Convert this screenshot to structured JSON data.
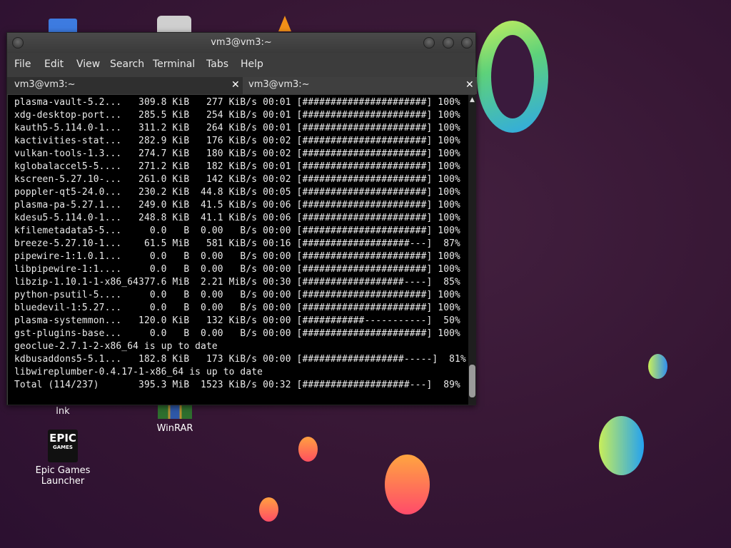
{
  "desktop": {
    "icons": [
      {
        "label": "lnk"
      },
      {
        "label": "WinRAR"
      },
      {
        "label": "Epic Games Launcher",
        "logo_text": "EPIC",
        "logo_sub": "GAMES"
      }
    ]
  },
  "window": {
    "title": "vm3@vm3:~",
    "menu": [
      "File",
      "Edit",
      "View",
      "Search",
      "Terminal",
      "Tabs",
      "Help"
    ],
    "tabs": [
      {
        "label": "vm3@vm3:~",
        "close": "✕"
      },
      {
        "label": "vm3@vm3:~",
        "close": "✕"
      }
    ]
  },
  "terminal": {
    "lines": [
      "plasma-vault-5.2...   309.8 KiB   277 KiB/s 00:01 [######################] 100%",
      "xdg-desktop-port...   285.5 KiB   254 KiB/s 00:01 [######################] 100%",
      "kauth5-5.114.0-1...   311.2 KiB   264 KiB/s 00:01 [######################] 100%",
      "kactivities-stat...   282.9 KiB   176 KiB/s 00:02 [######################] 100%",
      "vulkan-tools-1.3...   274.7 KiB   180 KiB/s 00:02 [######################] 100%",
      "kglobalaccel5-5....   271.2 KiB   182 KiB/s 00:01 [######################] 100%",
      "kscreen-5.27.10-...   261.0 KiB   142 KiB/s 00:02 [######################] 100%",
      "poppler-qt5-24.0...   230.2 KiB  44.8 KiB/s 00:05 [######################] 100%",
      "plasma-pa-5.27.1...   249.0 KiB  41.5 KiB/s 00:06 [######################] 100%",
      "kdesu5-5.114.0-1...   248.8 KiB  41.1 KiB/s 00:06 [######################] 100%",
      "kfilemetadata5-5...     0.0   B  0.00   B/s 00:00 [######################] 100%",
      "breeze-5.27.10-1...    61.5 MiB   581 KiB/s 00:16 [###################---]  87%",
      "pipewire-1:1.0.1...     0.0   B  0.00   B/s 00:00 [######################] 100%",
      "libpipewire-1:1....     0.0   B  0.00   B/s 00:00 [######################] 100%",
      "libzip-1.10.1-1-x86_64377.6 MiB  2.21 MiB/s 00:30 [##################----]  85%",
      "python-psutil-5....     0.0   B  0.00   B/s 00:00 [######################] 100%",
      "bluedevil-1:5.27...     0.0   B  0.00   B/s 00:00 [######################] 100%",
      "plasma-systemmon...   120.0 KiB   132 KiB/s 00:00 [###########-----------]  50%",
      "gst-plugins-base...     0.0   B  0.00   B/s 00:00 [######################] 100%",
      "geoclue-2.7.1-2-x86_64 is up to date",
      "kdbusaddons5-5.1...   182.8 KiB   173 KiB/s 00:00 [##################-----]  81%",
      "libwireplumber-0.4.17-1-x86_64 is up to date",
      "Total (114/237)       395.3 MiB  1523 KiB/s 00:32 [###################---]  89%"
    ]
  }
}
